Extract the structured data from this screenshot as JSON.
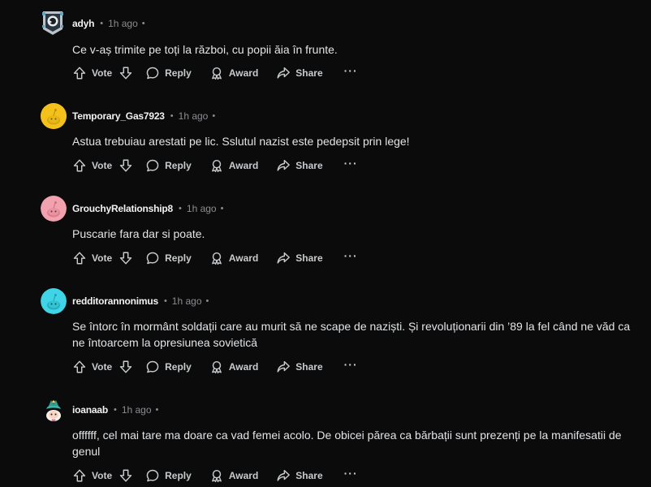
{
  "labels": {
    "vote": "Vote",
    "reply": "Reply",
    "award": "Award",
    "share": "Share",
    "more": "···",
    "dot": "•"
  },
  "comments": [
    {
      "username": "adyh",
      "time": "1h ago",
      "text": "Ce v-aș trimite pe toți la război, cu popii ăia în frunte.",
      "avatar": "pixel-avatar-icon"
    },
    {
      "username": "Temporary_Gas7923",
      "time": "1h ago",
      "text": "Astua trebuiau arestati pe lic. Sslutul nazist este pedepsit prin lege!",
      "avatar": "snoo-yellow-icon"
    },
    {
      "username": "GrouchyRelationship8",
      "time": "1h ago",
      "text": "Puscarie fara dar si poate.",
      "avatar": "snoo-pink-icon"
    },
    {
      "username": "redditorannonimus",
      "time": "1h ago",
      "text": "Se întorc în mormânt soldații care au murit să ne scape de naziști. Și revoluționarii din ’89 la fel când ne văd ca ne întoarcem la opresiunea sovietică",
      "avatar": "snoo-cyan-icon"
    },
    {
      "username": "ioanaab",
      "time": "1h ago",
      "text": "offffff, cel mai tare ma doare ca vad femei acolo. De obicei părea ca bărbații sunt prezenți pe la manifesatii de genul",
      "avatar": "snoo-custom-icon"
    }
  ],
  "colors": {
    "background": "#0b0b0c",
    "username": "#f2f2f2",
    "muted": "#8a8d90",
    "text": "#e2e4e6"
  }
}
